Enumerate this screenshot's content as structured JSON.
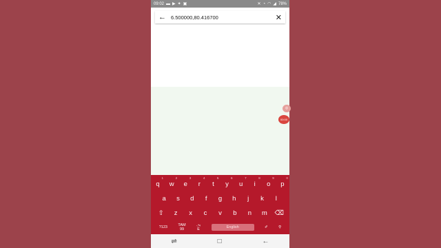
{
  "status_bar": {
    "time": "09:02",
    "battery": "78%",
    "left_icons": [
      "message-icon",
      "youtube-icon",
      "twitter-icon",
      "gallery-icon"
    ],
    "right_icons": [
      "mute-icon",
      "alarm-icon",
      "wifi-icon",
      "signal-icon"
    ]
  },
  "search": {
    "value": "6.500000,80.416700"
  },
  "keyboard": {
    "row1": [
      {
        "key": "q",
        "num": "1"
      },
      {
        "key": "w",
        "num": "2"
      },
      {
        "key": "e",
        "num": "3"
      },
      {
        "key": "r",
        "num": "4"
      },
      {
        "key": "t",
        "num": "5"
      },
      {
        "key": "y",
        "num": "6"
      },
      {
        "key": "u",
        "num": "7"
      },
      {
        "key": "i",
        "num": "8"
      },
      {
        "key": "o",
        "num": "9"
      },
      {
        "key": "p",
        "num": "0"
      }
    ],
    "row2": [
      "a",
      "s",
      "d",
      "f",
      "g",
      "h",
      "j",
      "k",
      "l"
    ],
    "row3": [
      "z",
      "x",
      "c",
      "v",
      "b",
      "n",
      "m"
    ],
    "symbols_key": "?123",
    "language_key_top": "TAM",
    "language_key_bottom": "99",
    "tamil_key_top": "அ",
    "tamil_key_bottom": "E",
    "space_label": "English"
  },
  "floating": {
    "float1": "◎",
    "float2": "00:00"
  },
  "colors": {
    "background": "#9c434b",
    "keyboard": "#b5192b",
    "map": "#f1f8f0"
  }
}
